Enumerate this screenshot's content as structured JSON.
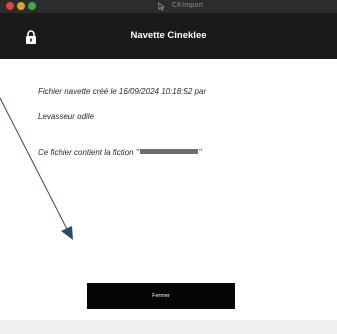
{
  "window": {
    "app_name": "CKImport",
    "app_icon": "pointer-cursor-icon"
  },
  "header": {
    "title": "Navette Cineklee",
    "lock_icon": "lock-icon"
  },
  "message": {
    "line1": "Fichier navette créé le 16/09/2024 10:18:52 par",
    "line2": "Levasseur odile",
    "line3_prefix": "Ce fichier contient la fiction \"",
    "line3_suffix": "\""
  },
  "actions": {
    "close_label": "Fermer"
  },
  "colors": {
    "header_bg": "#1a1a1a",
    "button_bg": "#050505",
    "annotation_arrow": "#2a4d6a"
  }
}
